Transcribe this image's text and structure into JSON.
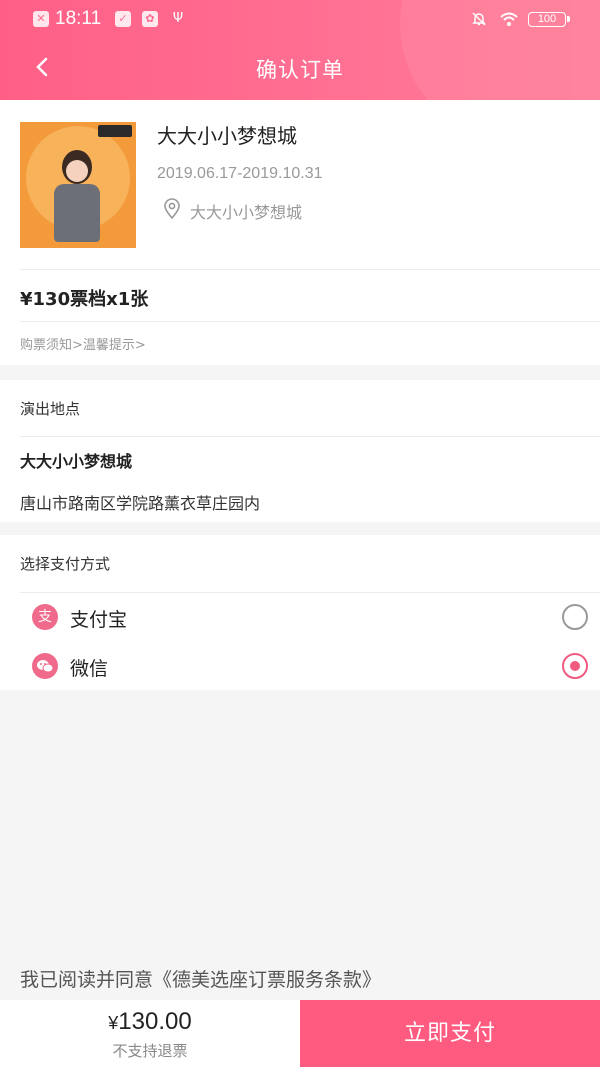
{
  "status_bar": {
    "time": "18:11",
    "battery": "100"
  },
  "header": {
    "title": "确认订单"
  },
  "event": {
    "title": "大大小小梦想城",
    "date_range": "2019.06.17-2019.10.31",
    "venue": "大大小小梦想城"
  },
  "ticket": {
    "summary": "¥130票档x1张",
    "notice_link": "购票须知>温馨提示>"
  },
  "location": {
    "section_label": "演出地点",
    "name": "大大小小梦想城",
    "address": "唐山市路南区学院路薰衣草庄园内"
  },
  "payment": {
    "section_label": "选择支付方式",
    "methods": [
      {
        "label": "支付宝",
        "icon": "alipay-icon",
        "selected": false
      },
      {
        "label": "微信",
        "icon": "wechat-icon",
        "selected": true
      }
    ]
  },
  "agreement": "我已阅读并同意《德美选座订票服务条款》",
  "footer": {
    "currency": "¥",
    "amount": "130.00",
    "refund_note": "不支持退票",
    "pay_button": "立即支付"
  },
  "colors": {
    "accent": "#ff5a80",
    "header_start": "#ff5f86",
    "header_end": "#ff7d9c"
  }
}
